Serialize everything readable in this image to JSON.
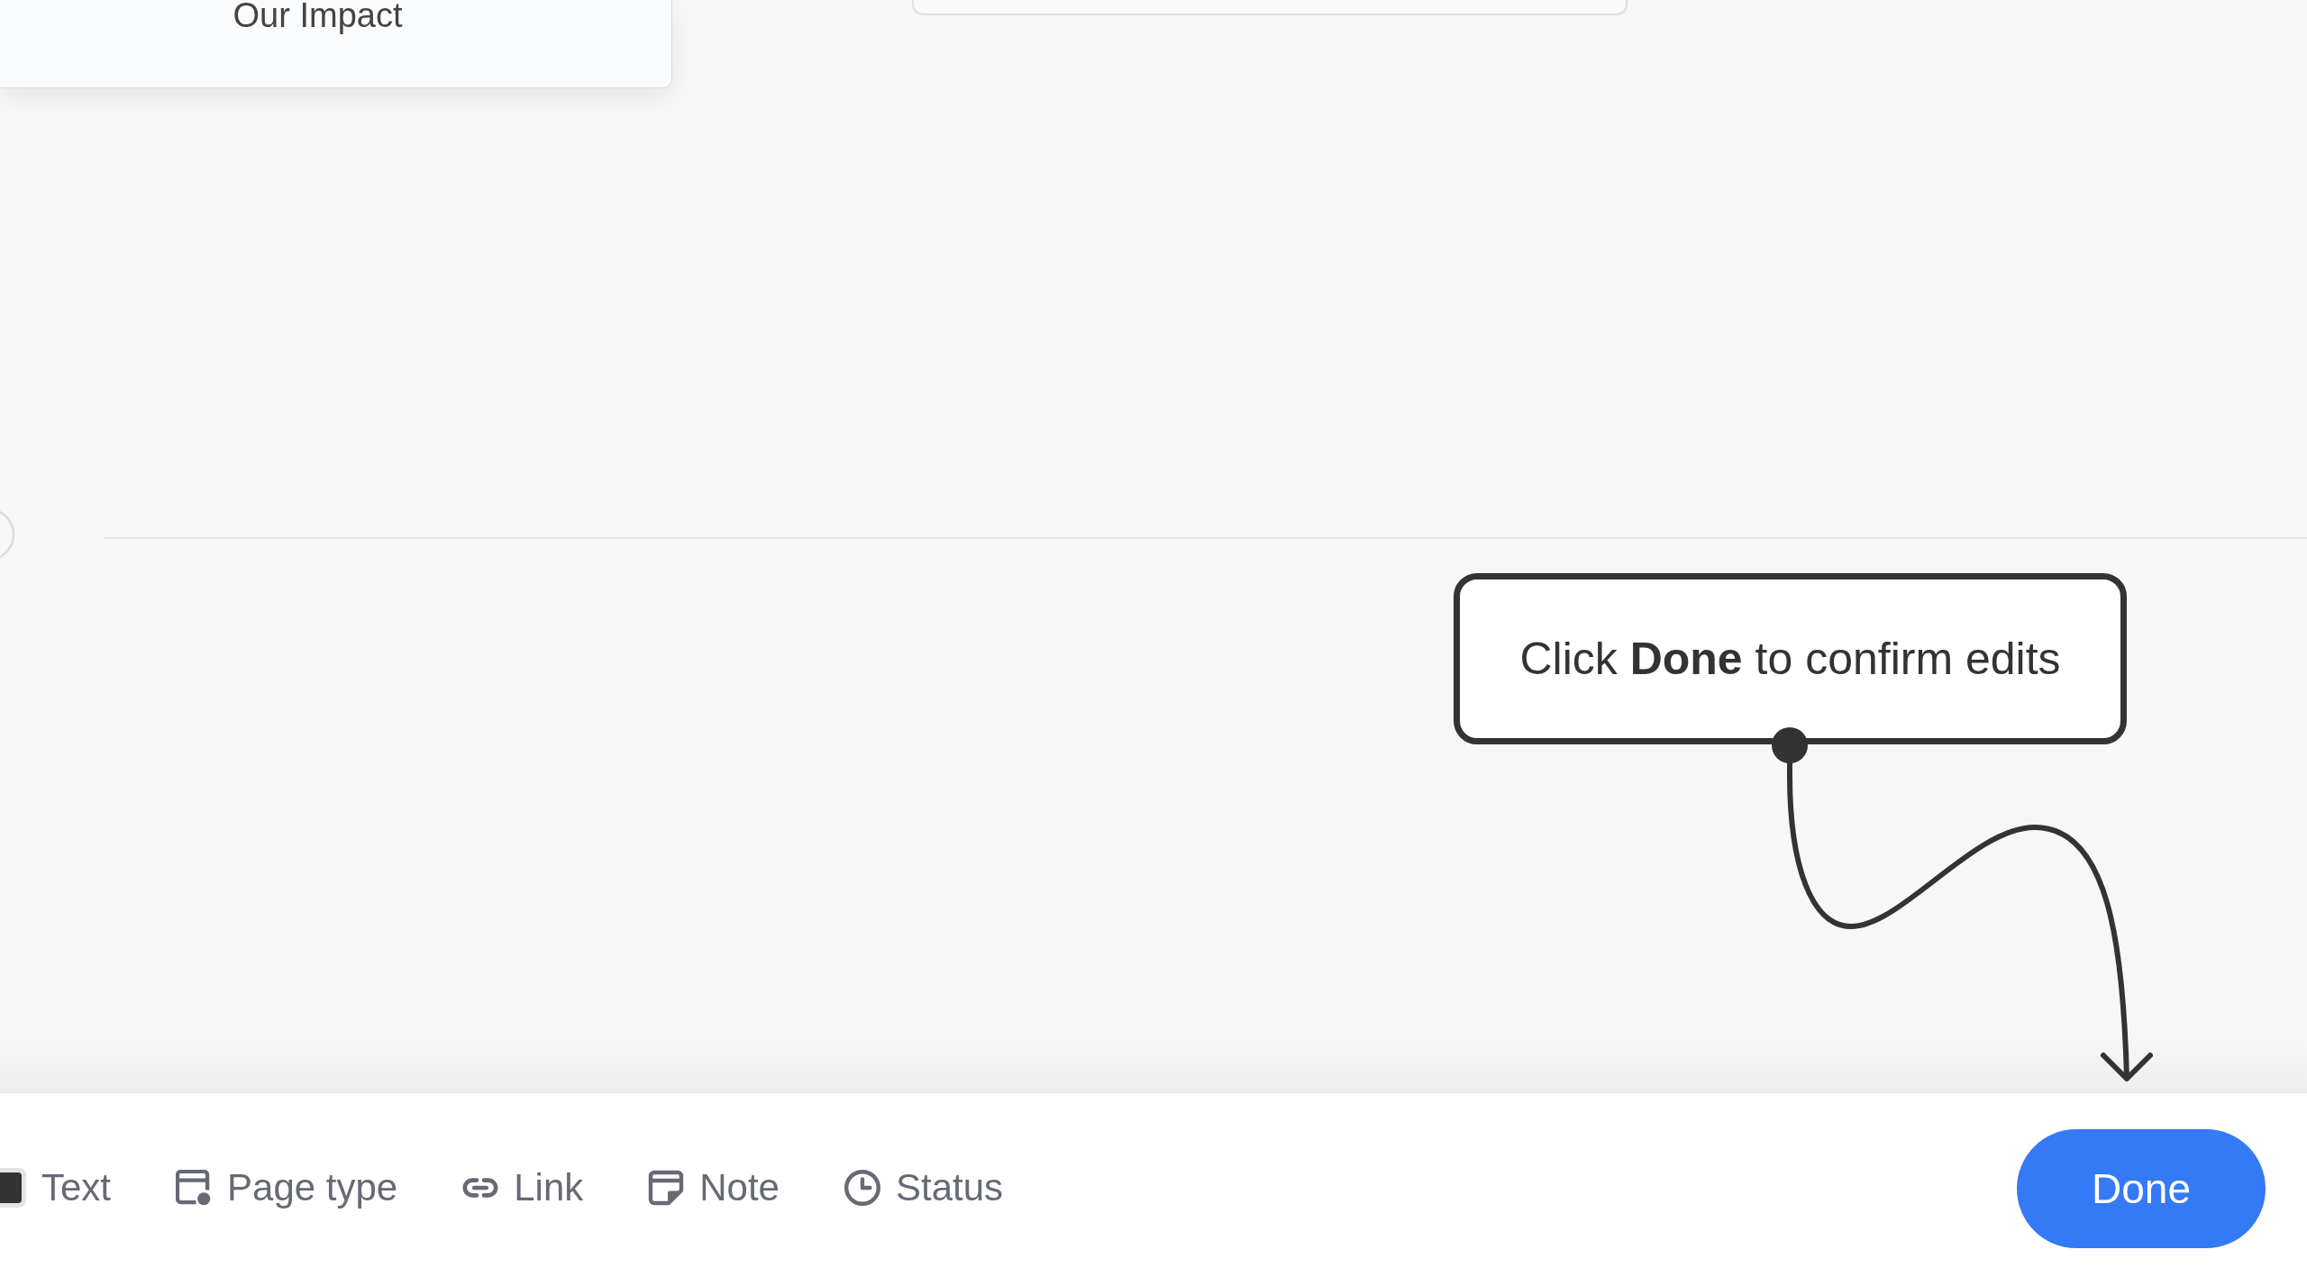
{
  "canvas": {
    "page_cards": [
      {
        "kind": "titled",
        "title": "Our Impact"
      },
      {
        "kind": "blank"
      }
    ],
    "hint": {
      "text": "Click **Done** to confirm edits"
    }
  },
  "toolbar": {
    "items": [
      {
        "kind": "text",
        "label": "Text"
      },
      {
        "kind": "pagetype",
        "label": "Page type"
      },
      {
        "kind": "link",
        "label": "Link"
      },
      {
        "kind": "note",
        "label": "Note"
      },
      {
        "kind": "status",
        "label": "Status"
      }
    ],
    "done_button": {
      "label": "Done"
    }
  }
}
